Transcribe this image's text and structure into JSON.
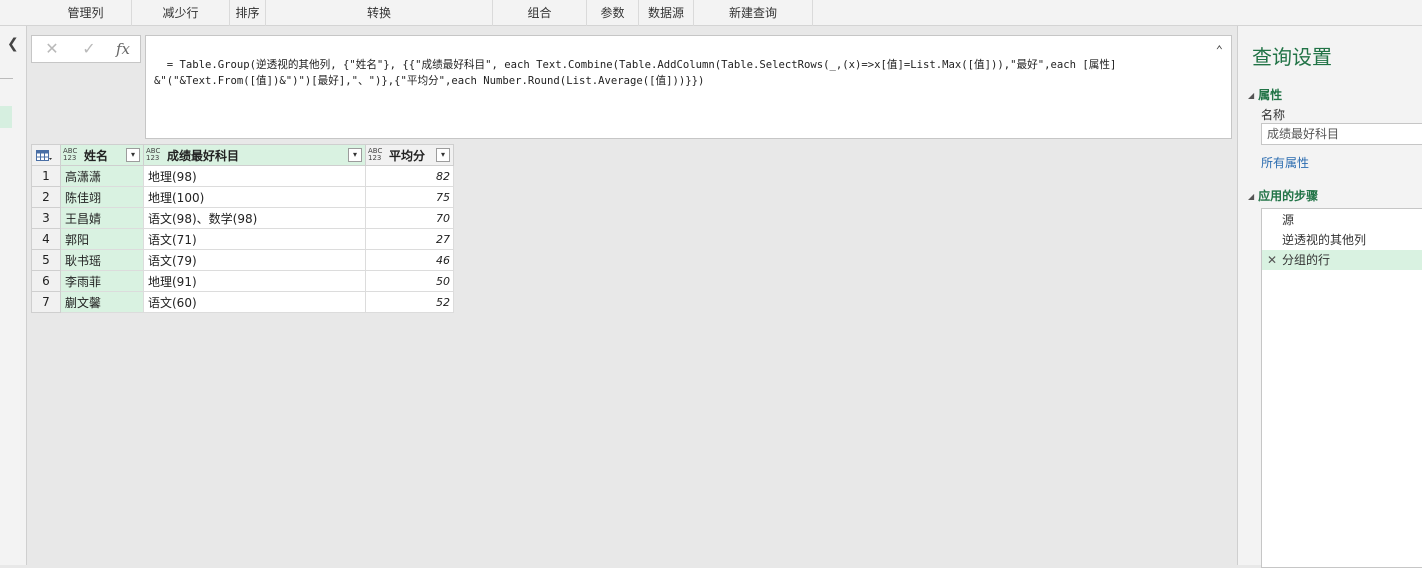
{
  "ribbon": {
    "groups": [
      "管理列",
      "减少行",
      "排序",
      "转换",
      "组合",
      "参数",
      "数据源",
      "新建查询"
    ]
  },
  "formula_bar": {
    "cancel_icon": "close-icon",
    "confirm_icon": "check-icon",
    "fx_label": "fx",
    "formula": "= Table.Group(逆透视的其他列, {\"姓名\"}, {{\"成绩最好科目\", each Text.Combine(Table.AddColumn(Table.SelectRows(_,(x)=>x[值]=List.Max([值])),\"最好\",each [属性]\n&\"(\"&Text.From([值])&\")\")[最好],\"、\")},{\"平均分\",each Number.Round(List.Average([值]))}})"
  },
  "table": {
    "columns": [
      {
        "type": "ABC 123",
        "label": "姓名"
      },
      {
        "type": "ABC 123",
        "label": "成绩最好科目"
      },
      {
        "type": "ABC 123",
        "label": "平均分"
      }
    ],
    "rows": [
      {
        "num": "1",
        "name": "高潇潇",
        "subject": "地理(98)",
        "avg": "82"
      },
      {
        "num": "2",
        "name": "陈佳翊",
        "subject": "地理(100)",
        "avg": "75"
      },
      {
        "num": "3",
        "name": "王昌婧",
        "subject": "语文(98)、数学(98)",
        "avg": "70"
      },
      {
        "num": "4",
        "name": "郭阳",
        "subject": "语文(71)",
        "avg": "27"
      },
      {
        "num": "5",
        "name": "耿书瑶",
        "subject": "语文(79)",
        "avg": "46"
      },
      {
        "num": "6",
        "name": "李雨菲",
        "subject": "地理(91)",
        "avg": "50"
      },
      {
        "num": "7",
        "name": "蒯文馨",
        "subject": "语文(60)",
        "avg": "52"
      }
    ]
  },
  "query_settings": {
    "title": "查询设置",
    "properties_heading": "属性",
    "name_label": "名称",
    "name_value": "成绩最好科目",
    "all_properties_link": "所有属性",
    "applied_steps_heading": "应用的步骤",
    "steps": [
      "源",
      "逆透视的其他列",
      "分组的行"
    ]
  },
  "colors": {
    "accent": "#217346",
    "selection": "#d9f2e1",
    "link": "#2b6cb0"
  }
}
